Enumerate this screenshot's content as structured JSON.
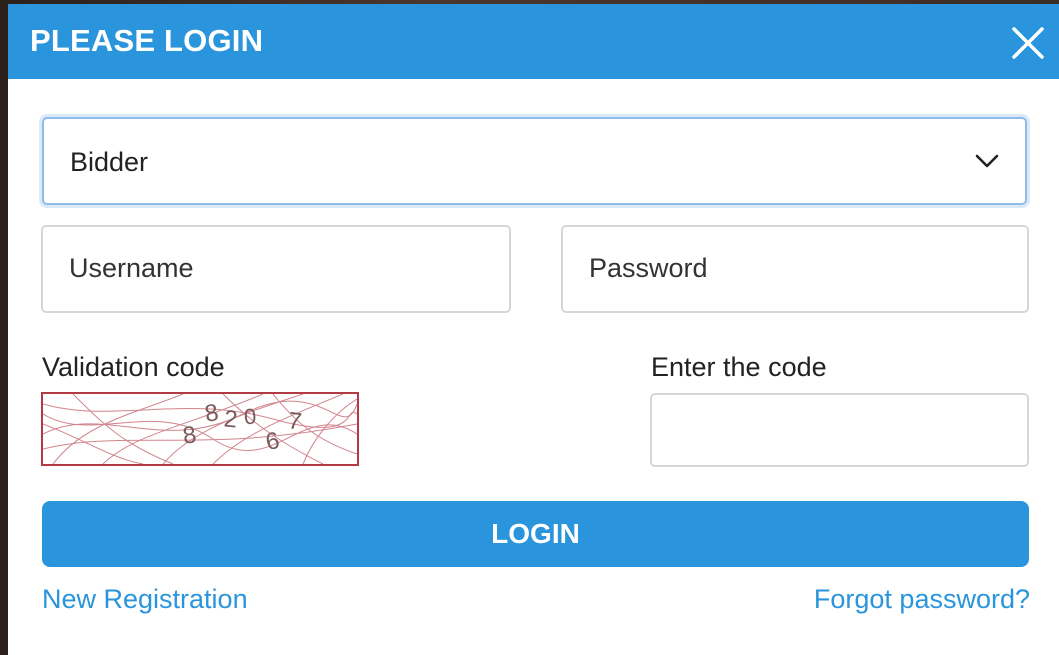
{
  "dialog": {
    "title": "PLEASE LOGIN",
    "close_icon": "close-icon"
  },
  "form": {
    "role_select": {
      "value": "Bidder",
      "icon": "chevron-down-icon"
    },
    "username": {
      "placeholder": "Username"
    },
    "password": {
      "placeholder": "Password"
    },
    "validation_label": "Validation code",
    "captcha": {
      "characters": [
        "8",
        "8",
        "2",
        "0",
        "6",
        "7"
      ]
    },
    "enter_code_label": "Enter the code",
    "enter_code": {
      "value": ""
    },
    "login_label": "LOGIN"
  },
  "links": {
    "new_registration": "New Registration",
    "forgot_password": "Forgot password?"
  },
  "colors": {
    "accent": "#2a95dc",
    "captcha_border": "#b23a45"
  }
}
